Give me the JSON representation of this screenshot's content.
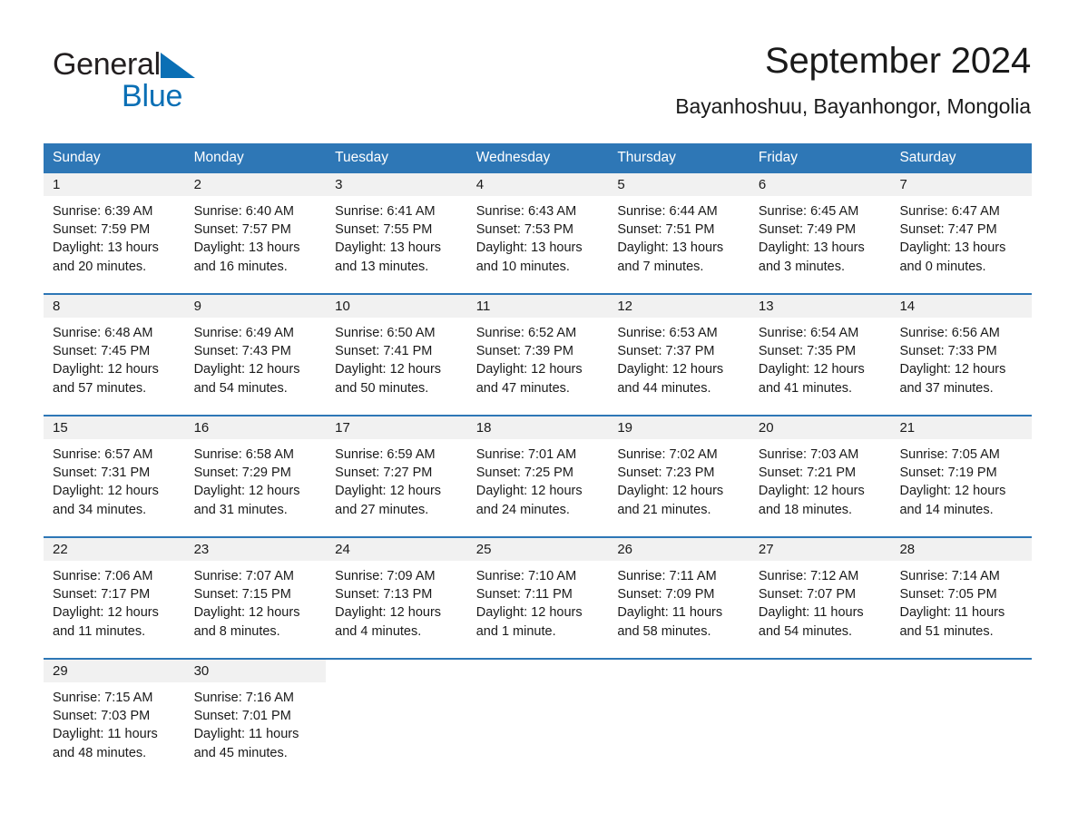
{
  "brand": {
    "name_part1": "General",
    "name_part2": "Blue",
    "triangle_color": "#0a6fb5"
  },
  "header": {
    "title": "September 2024",
    "subtitle": "Bayanhoshuu, Bayanhongor, Mongolia"
  },
  "colors": {
    "header_blue": "#2e77b6",
    "daynum_band": "#f1f1f1",
    "text": "#1a1a1a"
  },
  "weekday_headers": [
    "Sunday",
    "Monday",
    "Tuesday",
    "Wednesday",
    "Thursday",
    "Friday",
    "Saturday"
  ],
  "weeks": [
    [
      {
        "day": "1",
        "sunrise": "Sunrise: 6:39 AM",
        "sunset": "Sunset: 7:59 PM",
        "daylight_1": "Daylight: 13 hours",
        "daylight_2": "and 20 minutes."
      },
      {
        "day": "2",
        "sunrise": "Sunrise: 6:40 AM",
        "sunset": "Sunset: 7:57 PM",
        "daylight_1": "Daylight: 13 hours",
        "daylight_2": "and 16 minutes."
      },
      {
        "day": "3",
        "sunrise": "Sunrise: 6:41 AM",
        "sunset": "Sunset: 7:55 PM",
        "daylight_1": "Daylight: 13 hours",
        "daylight_2": "and 13 minutes."
      },
      {
        "day": "4",
        "sunrise": "Sunrise: 6:43 AM",
        "sunset": "Sunset: 7:53 PM",
        "daylight_1": "Daylight: 13 hours",
        "daylight_2": "and 10 minutes."
      },
      {
        "day": "5",
        "sunrise": "Sunrise: 6:44 AM",
        "sunset": "Sunset: 7:51 PM",
        "daylight_1": "Daylight: 13 hours",
        "daylight_2": "and 7 minutes."
      },
      {
        "day": "6",
        "sunrise": "Sunrise: 6:45 AM",
        "sunset": "Sunset: 7:49 PM",
        "daylight_1": "Daylight: 13 hours",
        "daylight_2": "and 3 minutes."
      },
      {
        "day": "7",
        "sunrise": "Sunrise: 6:47 AM",
        "sunset": "Sunset: 7:47 PM",
        "daylight_1": "Daylight: 13 hours",
        "daylight_2": "and 0 minutes."
      }
    ],
    [
      {
        "day": "8",
        "sunrise": "Sunrise: 6:48 AM",
        "sunset": "Sunset: 7:45 PM",
        "daylight_1": "Daylight: 12 hours",
        "daylight_2": "and 57 minutes."
      },
      {
        "day": "9",
        "sunrise": "Sunrise: 6:49 AM",
        "sunset": "Sunset: 7:43 PM",
        "daylight_1": "Daylight: 12 hours",
        "daylight_2": "and 54 minutes."
      },
      {
        "day": "10",
        "sunrise": "Sunrise: 6:50 AM",
        "sunset": "Sunset: 7:41 PM",
        "daylight_1": "Daylight: 12 hours",
        "daylight_2": "and 50 minutes."
      },
      {
        "day": "11",
        "sunrise": "Sunrise: 6:52 AM",
        "sunset": "Sunset: 7:39 PM",
        "daylight_1": "Daylight: 12 hours",
        "daylight_2": "and 47 minutes."
      },
      {
        "day": "12",
        "sunrise": "Sunrise: 6:53 AM",
        "sunset": "Sunset: 7:37 PM",
        "daylight_1": "Daylight: 12 hours",
        "daylight_2": "and 44 minutes."
      },
      {
        "day": "13",
        "sunrise": "Sunrise: 6:54 AM",
        "sunset": "Sunset: 7:35 PM",
        "daylight_1": "Daylight: 12 hours",
        "daylight_2": "and 41 minutes."
      },
      {
        "day": "14",
        "sunrise": "Sunrise: 6:56 AM",
        "sunset": "Sunset: 7:33 PM",
        "daylight_1": "Daylight: 12 hours",
        "daylight_2": "and 37 minutes."
      }
    ],
    [
      {
        "day": "15",
        "sunrise": "Sunrise: 6:57 AM",
        "sunset": "Sunset: 7:31 PM",
        "daylight_1": "Daylight: 12 hours",
        "daylight_2": "and 34 minutes."
      },
      {
        "day": "16",
        "sunrise": "Sunrise: 6:58 AM",
        "sunset": "Sunset: 7:29 PM",
        "daylight_1": "Daylight: 12 hours",
        "daylight_2": "and 31 minutes."
      },
      {
        "day": "17",
        "sunrise": "Sunrise: 6:59 AM",
        "sunset": "Sunset: 7:27 PM",
        "daylight_1": "Daylight: 12 hours",
        "daylight_2": "and 27 minutes."
      },
      {
        "day": "18",
        "sunrise": "Sunrise: 7:01 AM",
        "sunset": "Sunset: 7:25 PM",
        "daylight_1": "Daylight: 12 hours",
        "daylight_2": "and 24 minutes."
      },
      {
        "day": "19",
        "sunrise": "Sunrise: 7:02 AM",
        "sunset": "Sunset: 7:23 PM",
        "daylight_1": "Daylight: 12 hours",
        "daylight_2": "and 21 minutes."
      },
      {
        "day": "20",
        "sunrise": "Sunrise: 7:03 AM",
        "sunset": "Sunset: 7:21 PM",
        "daylight_1": "Daylight: 12 hours",
        "daylight_2": "and 18 minutes."
      },
      {
        "day": "21",
        "sunrise": "Sunrise: 7:05 AM",
        "sunset": "Sunset: 7:19 PM",
        "daylight_1": "Daylight: 12 hours",
        "daylight_2": "and 14 minutes."
      }
    ],
    [
      {
        "day": "22",
        "sunrise": "Sunrise: 7:06 AM",
        "sunset": "Sunset: 7:17 PM",
        "daylight_1": "Daylight: 12 hours",
        "daylight_2": "and 11 minutes."
      },
      {
        "day": "23",
        "sunrise": "Sunrise: 7:07 AM",
        "sunset": "Sunset: 7:15 PM",
        "daylight_1": "Daylight: 12 hours",
        "daylight_2": "and 8 minutes."
      },
      {
        "day": "24",
        "sunrise": "Sunrise: 7:09 AM",
        "sunset": "Sunset: 7:13 PM",
        "daylight_1": "Daylight: 12 hours",
        "daylight_2": "and 4 minutes."
      },
      {
        "day": "25",
        "sunrise": "Sunrise: 7:10 AM",
        "sunset": "Sunset: 7:11 PM",
        "daylight_1": "Daylight: 12 hours",
        "daylight_2": "and 1 minute."
      },
      {
        "day": "26",
        "sunrise": "Sunrise: 7:11 AM",
        "sunset": "Sunset: 7:09 PM",
        "daylight_1": "Daylight: 11 hours",
        "daylight_2": "and 58 minutes."
      },
      {
        "day": "27",
        "sunrise": "Sunrise: 7:12 AM",
        "sunset": "Sunset: 7:07 PM",
        "daylight_1": "Daylight: 11 hours",
        "daylight_2": "and 54 minutes."
      },
      {
        "day": "28",
        "sunrise": "Sunrise: 7:14 AM",
        "sunset": "Sunset: 7:05 PM",
        "daylight_1": "Daylight: 11 hours",
        "daylight_2": "and 51 minutes."
      }
    ],
    [
      {
        "day": "29",
        "sunrise": "Sunrise: 7:15 AM",
        "sunset": "Sunset: 7:03 PM",
        "daylight_1": "Daylight: 11 hours",
        "daylight_2": "and 48 minutes."
      },
      {
        "day": "30",
        "sunrise": "Sunrise: 7:16 AM",
        "sunset": "Sunset: 7:01 PM",
        "daylight_1": "Daylight: 11 hours",
        "daylight_2": "and 45 minutes."
      },
      {
        "day": "",
        "sunrise": "",
        "sunset": "",
        "daylight_1": "",
        "daylight_2": ""
      },
      {
        "day": "",
        "sunrise": "",
        "sunset": "",
        "daylight_1": "",
        "daylight_2": ""
      },
      {
        "day": "",
        "sunrise": "",
        "sunset": "",
        "daylight_1": "",
        "daylight_2": ""
      },
      {
        "day": "",
        "sunrise": "",
        "sunset": "",
        "daylight_1": "",
        "daylight_2": ""
      },
      {
        "day": "",
        "sunrise": "",
        "sunset": "",
        "daylight_1": "",
        "daylight_2": ""
      }
    ]
  ]
}
